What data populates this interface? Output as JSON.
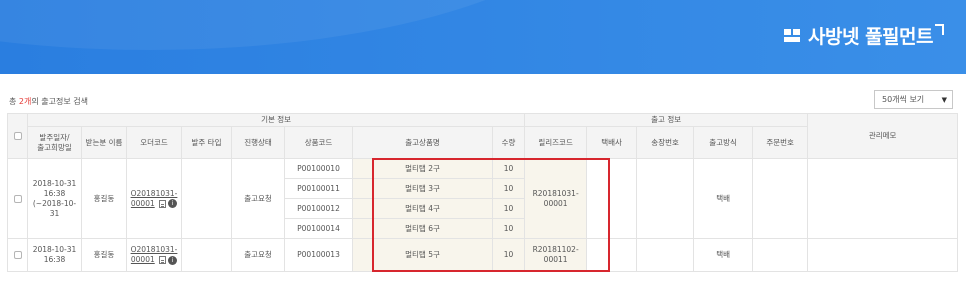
{
  "brand": {
    "name": "사방넷 풀필먼트"
  },
  "search": {
    "prefix": "총 ",
    "count": "2개",
    "suffix": "의 출고정보 검색"
  },
  "page_size": {
    "value": "50개씩 보기",
    "caret": "▼"
  },
  "table": {
    "group_basic": "기본 정보",
    "group_ship": "출고 정보",
    "memo_header": "관리메모",
    "headers": {
      "date": "발주일자/\n출고희망일",
      "receiver": "받는분 이름",
      "order_code": "오더코드",
      "order_type": "발주 타입",
      "status": "진행상태",
      "product_code": "상품코드",
      "product_name": "출고상품명",
      "qty": "수량",
      "release_code": "릴리즈코드",
      "courier": "택배사",
      "invoice": "송장번호",
      "ship_method": "출고방식",
      "order_no": "주문번호"
    },
    "orders": [
      {
        "date": "2018-10-31\n16:38\n(~2018-10-31",
        "receiver": "홍길동",
        "order_code": "O20181031-\n00001",
        "order_type": "",
        "status": "출고요청",
        "release_code": "R20181031-\n00001",
        "courier": "",
        "invoice": "",
        "ship_method": "택배",
        "order_no": "",
        "memo": "",
        "items": [
          {
            "product_code": "P00100010",
            "name": "멀티탭 2구",
            "qty": "10"
          },
          {
            "product_code": "P00100011",
            "name": "멀티탭 3구",
            "qty": "10"
          },
          {
            "product_code": "P00100012",
            "name": "멀티탭 4구",
            "qty": "10"
          },
          {
            "product_code": "P00100014",
            "name": "멀티탭 6구",
            "qty": "10"
          }
        ]
      },
      {
        "date": "2018-10-31\n16:38",
        "receiver": "홍길동",
        "order_code": "O20181031-\n00001",
        "order_type": "",
        "status": "출고요청",
        "release_code": "R20181102-\n00011",
        "courier": "",
        "invoice": "",
        "ship_method": "택배",
        "order_no": "",
        "memo": "",
        "items": [
          {
            "product_code": "P00100013",
            "name": "멀티탭 5구",
            "qty": "10"
          }
        ]
      }
    ]
  },
  "icons": {
    "order_doc": "document-icon",
    "order_round": "circle-info-icon",
    "badge_glyph": "i"
  },
  "colors": {
    "banner": "#3a8fe8",
    "highlight_border": "#d7262e",
    "count_text": "#e53935"
  }
}
